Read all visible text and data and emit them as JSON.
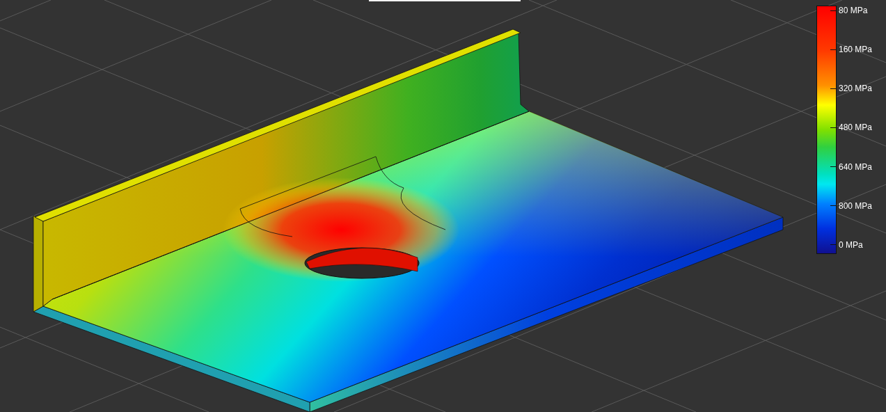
{
  "legend": {
    "labels": [
      "80 MPa",
      "160 MPa",
      "320 MPa",
      "480 MPa",
      "640 MPa",
      "800 MPa",
      "0 MPa"
    ]
  }
}
